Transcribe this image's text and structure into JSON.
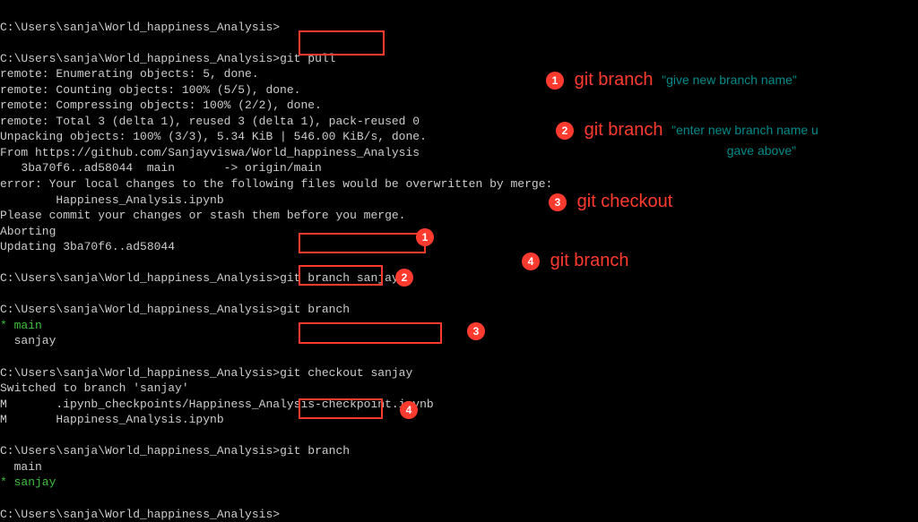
{
  "terminal": {
    "prompt": "C:\\Users\\sanja\\World_happiness_Analysis>",
    "block0_cmd": "",
    "block1_cmd": "git pull",
    "git_output": [
      "remote: Enumerating objects: 5, done.",
      "remote: Counting objects: 100% (5/5), done.",
      "remote: Compressing objects: 100% (2/2), done.",
      "remote: Total 3 (delta 1), reused 3 (delta 1), pack-reused 0",
      "Unpacking objects: 100% (3/3), 5.34 KiB | 546.00 KiB/s, done.",
      "From https://github.com/Sanjayviswa/World_happiness_Analysis",
      "   3ba70f6..ad58044  main       -> origin/main",
      "error: Your local changes to the following files would be overwritten by merge:",
      "        Happiness_Analysis.ipynb",
      "Please commit your changes or stash them before you merge.",
      "Aborting",
      "Updating 3ba70f6..ad58044"
    ],
    "block2_cmd": "git branch sanjay",
    "block3_cmd": "git branch",
    "branch_list1_active": "* main",
    "branch_list1_other": "  sanjay",
    "block4_cmd": "git checkout sanjay",
    "checkout_out1": "Switched to branch 'sanjay'",
    "checkout_out2": "M       .ipynb_checkpoints/Happiness_Analysis-checkpoint.ipynb",
    "checkout_out3": "M       Happiness_Analysis.ipynb",
    "block5_cmd": "git branch",
    "branch_list2_other": "  main",
    "branch_list2_active": "* sanjay",
    "block6_cmd": ""
  },
  "callouts": {
    "n1": "1",
    "n2": "2",
    "n3": "3",
    "n4": "4"
  },
  "legend": {
    "item1_cmd": "git branch",
    "item1_note": "\"give new branch name\"",
    "item2_cmd": "git branch",
    "item2_note": "\"enter new branch name u",
    "item2_note2": "gave above\"",
    "item3_cmd": "git checkout",
    "item4_cmd": "git branch"
  }
}
